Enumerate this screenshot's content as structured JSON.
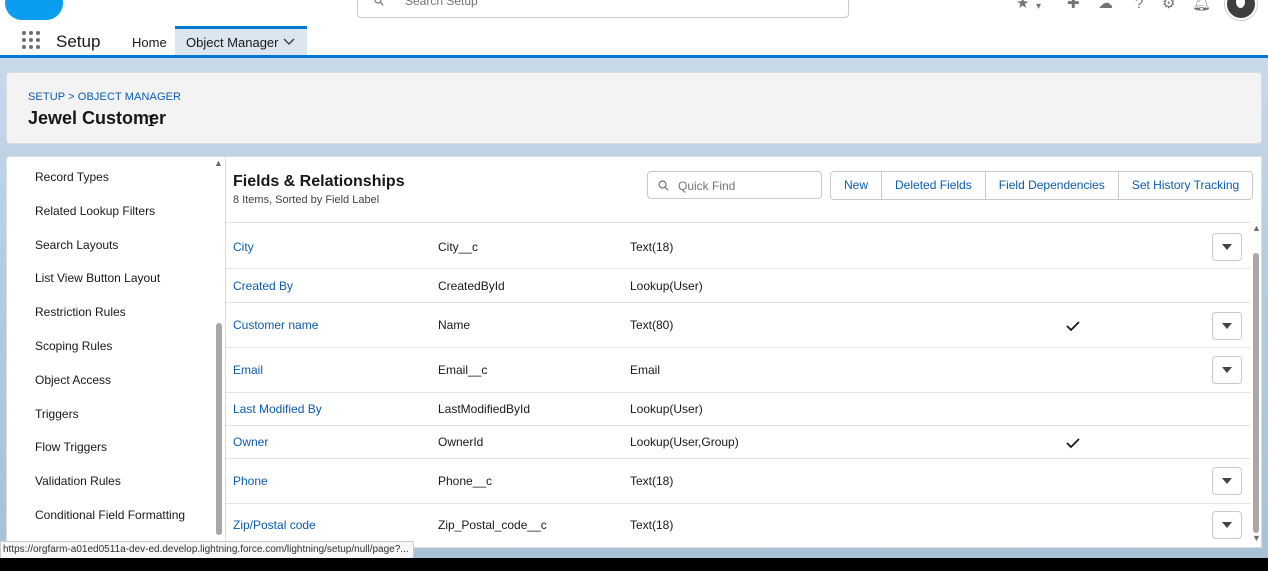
{
  "global_header": {
    "search_placeholder": "Search Setup"
  },
  "nav": {
    "app_name": "Setup",
    "items": [
      {
        "label": "Home"
      },
      {
        "label": "Object Manager"
      }
    ]
  },
  "object_header": {
    "breadcrumb": "SETUP > OBJECT MANAGER",
    "title": "Jewel Customer"
  },
  "sidebar": {
    "items": [
      {
        "label": "Record Types"
      },
      {
        "label": "Related Lookup Filters"
      },
      {
        "label": "Search Layouts"
      },
      {
        "label": "List View Button Layout"
      },
      {
        "label": "Restriction Rules"
      },
      {
        "label": "Scoping Rules"
      },
      {
        "label": "Object Access"
      },
      {
        "label": "Triggers"
      },
      {
        "label": "Flow Triggers"
      },
      {
        "label": "Validation Rules"
      },
      {
        "label": "Conditional Field Formatting"
      }
    ]
  },
  "main": {
    "title": "Fields & Relationships",
    "subtitle": "8 Items, Sorted by Field Label",
    "quick_find_placeholder": "Quick Find",
    "buttons": [
      {
        "label": "New"
      },
      {
        "label": "Deleted Fields"
      },
      {
        "label": "Field Dependencies"
      },
      {
        "label": "Set History Tracking"
      }
    ],
    "rows": [
      {
        "label": "City",
        "api_name": "City__c",
        "type": "Text(18)",
        "indexed": false,
        "menu": true
      },
      {
        "label": "Created By",
        "api_name": "CreatedById",
        "type": "Lookup(User)",
        "indexed": false,
        "menu": false
      },
      {
        "label": "Customer name",
        "api_name": "Name",
        "type": "Text(80)",
        "indexed": true,
        "menu": true
      },
      {
        "label": "Email",
        "api_name": "Email__c",
        "type": "Email",
        "indexed": false,
        "menu": true
      },
      {
        "label": "Last Modified By",
        "api_name": "LastModifiedById",
        "type": "Lookup(User)",
        "indexed": false,
        "menu": false
      },
      {
        "label": "Owner",
        "api_name": "OwnerId",
        "type": "Lookup(User,Group)",
        "indexed": true,
        "menu": false
      },
      {
        "label": "Phone",
        "api_name": "Phone__c",
        "type": "Text(18)",
        "indexed": false,
        "menu": true
      },
      {
        "label": "Zip/Postal code",
        "api_name": "Zip_Postal_code__c",
        "type": "Text(18)",
        "indexed": false,
        "menu": true
      }
    ]
  },
  "status_bar": {
    "url": "https://orgfarm-a01ed0511a-dev-ed.develop.lightning.force.com/lightning/setup/null/page?..."
  },
  "colors": {
    "brand": "#0176d3",
    "link": "#0b5cab",
    "logo": "#0b9ef0"
  }
}
